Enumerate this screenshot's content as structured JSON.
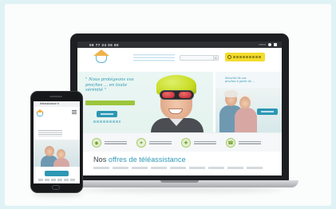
{
  "laptop": {
    "topbar_phone": "09 77 24 05 60",
    "hero_text": "\" Nous protégeons vos proches ... en toute sérénité \"",
    "hero_right_text": "Sécurité de vos proches à partir de ...",
    "section_title_prefix": "Nos",
    "section_title_main": "offres de téléassistance"
  },
  "phone": {
    "url": "téléassistance.fr"
  },
  "colors": {
    "brand_blue": "#2d97b4",
    "accent_green": "#9cc63c",
    "cta_yellow": "#f3dc2d",
    "background": "#dff3f6"
  }
}
